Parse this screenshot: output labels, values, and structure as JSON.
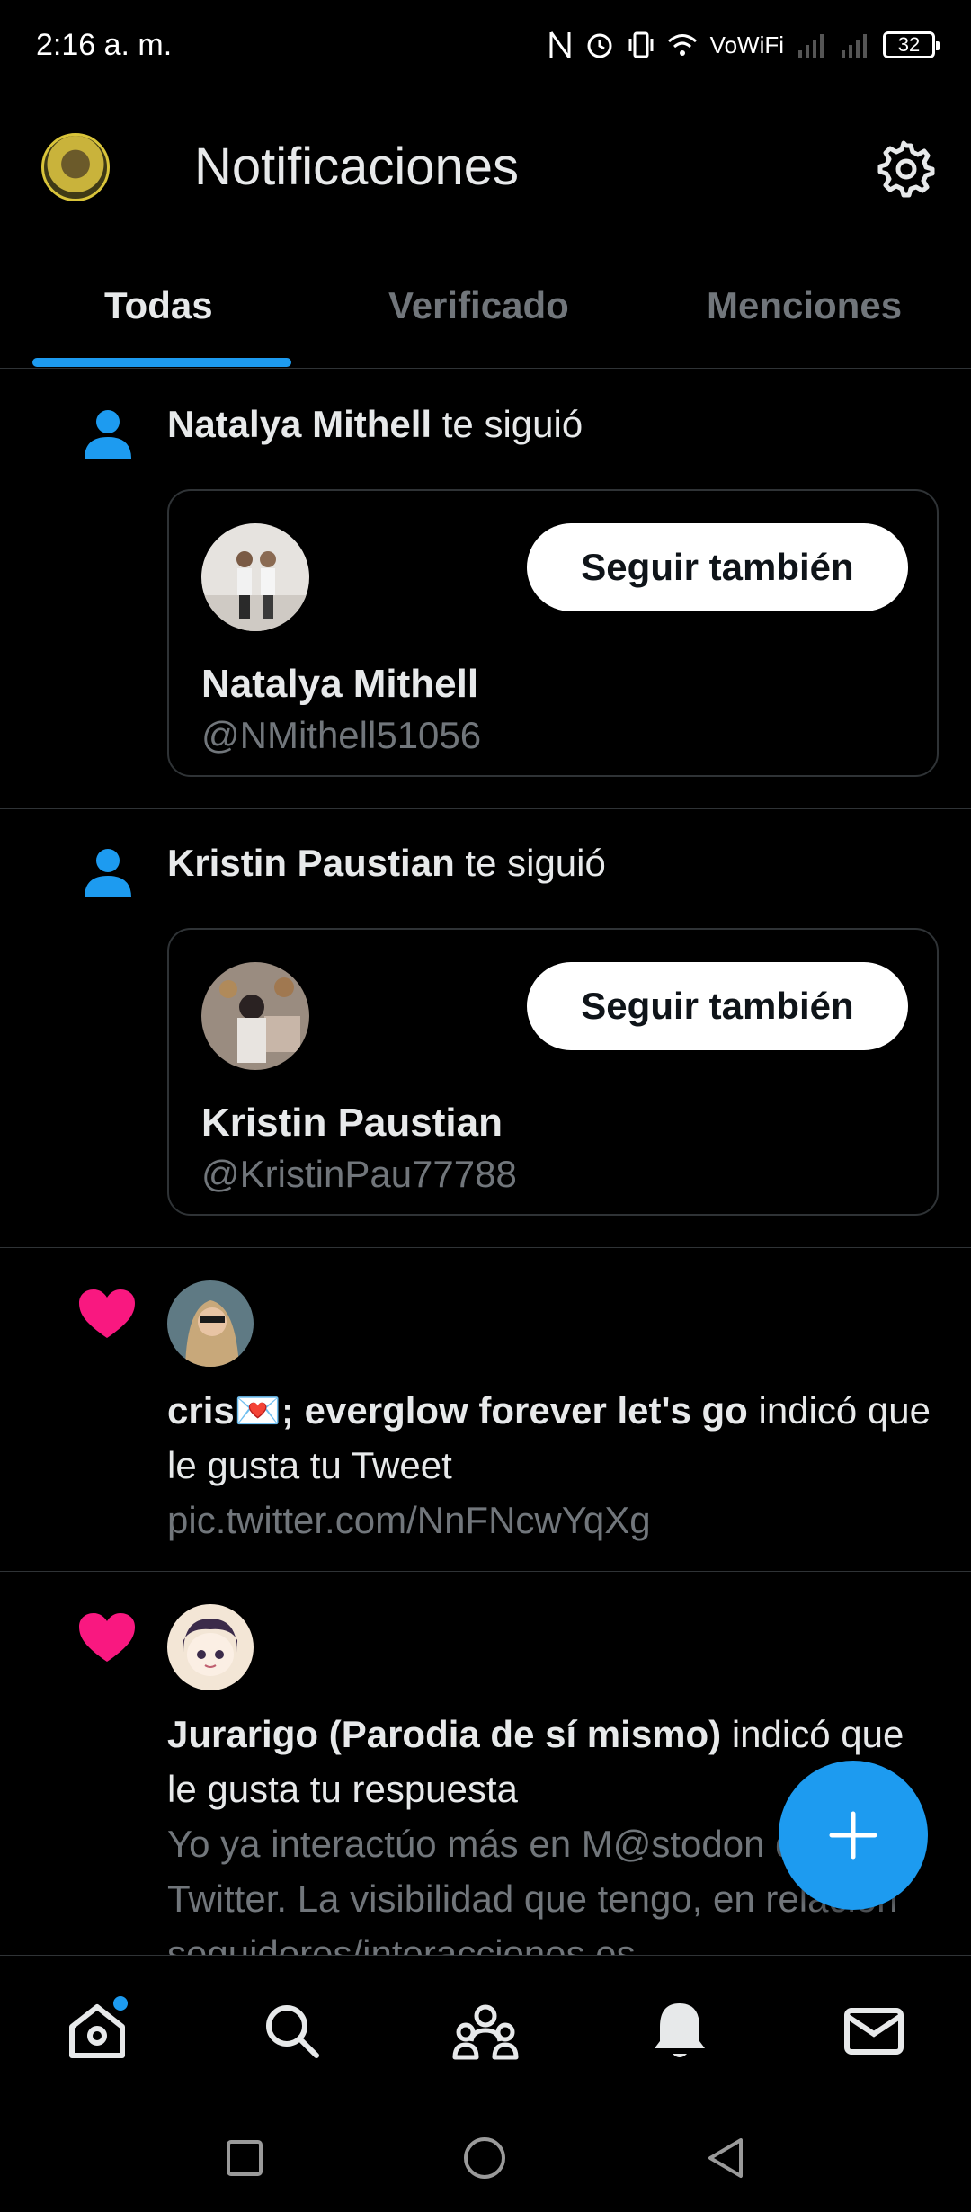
{
  "status_bar": {
    "time": "2:16 a. m.",
    "network_label": "VoWiFi",
    "battery": "32",
    "icons": [
      "nfc-icon",
      "alarm-icon",
      "vibrate-icon",
      "wifi-icon",
      "signal-icon",
      "signal-icon",
      "battery-icon"
    ]
  },
  "header": {
    "title": "Notificaciones",
    "icons": [
      "profile-avatar",
      "gear-icon"
    ]
  },
  "tabs": [
    {
      "label": "Todas",
      "active": true
    },
    {
      "label": "Verificado",
      "active": false
    },
    {
      "label": "Menciones",
      "active": false
    }
  ],
  "notifications": [
    {
      "type": "follow",
      "icon": "person-icon",
      "actor": "Natalya Mithell",
      "action": " te siguió",
      "card": {
        "name": "Natalya Mithell",
        "handle": "@NMithell51056",
        "button": "Seguir también"
      }
    },
    {
      "type": "follow",
      "icon": "person-icon",
      "actor": "Kristin Paustian",
      "action": " te siguió",
      "card": {
        "name": "Kristin Paustian",
        "handle": "@KristinPau77788",
        "button": "Seguir también"
      }
    },
    {
      "type": "like",
      "icon": "heart-icon",
      "actor": "cris💌; everglow forever let's go",
      "action": " indicó que le gusta tu Tweet",
      "preview": "pic.twitter.com/NnFNcwYqXg"
    },
    {
      "type": "like",
      "icon": "heart-icon",
      "actor": "Jurarigo (Parodia de sí mismo)",
      "action": " indicó que le gusta tu respuesta",
      "preview": "Yo ya interactúo más en M@stodon que en Twitter. La visibilidad que tengo, en relación seguidores/interacciones es"
    }
  ],
  "fab": {
    "icon": "plus-icon"
  },
  "bottom_nav": [
    {
      "name": "home",
      "icon": "home-icon",
      "has_dot": true
    },
    {
      "name": "search",
      "icon": "search-icon",
      "has_dot": false
    },
    {
      "name": "communities",
      "icon": "communities-icon",
      "has_dot": false
    },
    {
      "name": "notifications",
      "icon": "bell-icon",
      "has_dot": false
    },
    {
      "name": "messages",
      "icon": "mail-icon",
      "has_dot": false
    }
  ],
  "system_nav": [
    "recent-apps-icon",
    "home-circle-icon",
    "back-icon"
  ],
  "colors": {
    "accent": "#1d9bf0",
    "like": "#f91880",
    "background": "#000000",
    "muted": "#71767b"
  }
}
